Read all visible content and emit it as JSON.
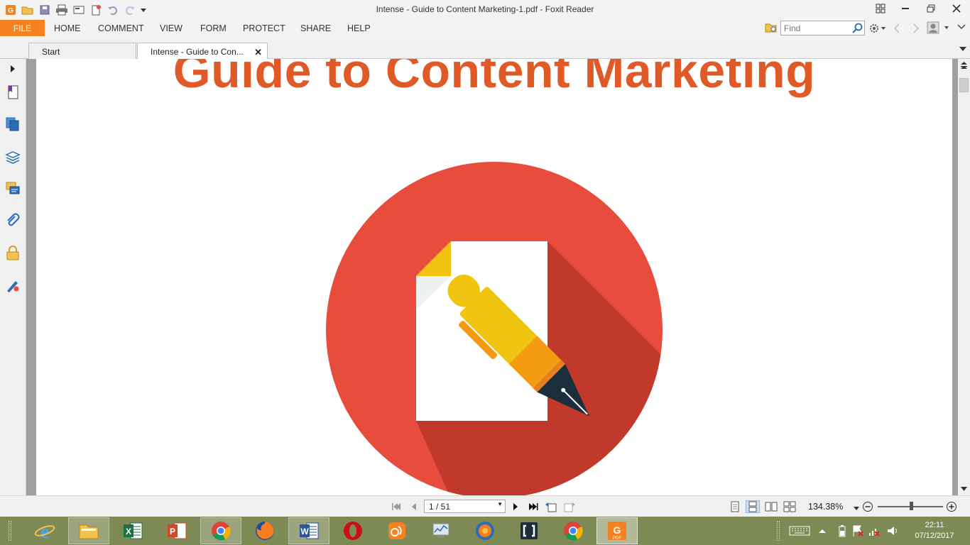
{
  "window": {
    "title": "Intense - Guide to Content Marketing-1.pdf - Foxit Reader"
  },
  "menu": {
    "file": "FILE",
    "items": [
      "HOME",
      "COMMENT",
      "VIEW",
      "FORM",
      "PROTECT",
      "SHARE",
      "HELP"
    ]
  },
  "search": {
    "placeholder": "Find"
  },
  "tabs": {
    "start": "Start",
    "active": "Intense - Guide to Con...",
    "close_glyph": "✕"
  },
  "document": {
    "heading": "Guide to Content Marketing"
  },
  "statusbar": {
    "page_indicator": "1 / 51",
    "zoom": "134.38%"
  },
  "taskbar": {
    "apps": [
      "internet-explorer",
      "file-explorer",
      "excel",
      "powerpoint",
      "chrome",
      "firefox",
      "word",
      "opera",
      "uc-browser",
      "performance-monitor",
      "firefox-developer",
      "bracket-app",
      "chrome",
      "foxit-reader"
    ]
  },
  "clock": {
    "time": "22:11",
    "date": "07/12/2017"
  },
  "colors": {
    "accent_orange": "#f58220",
    "heading_orange": "#e05a28",
    "circle_red": "#e74c3c",
    "taskbar": "#7e8a56"
  }
}
